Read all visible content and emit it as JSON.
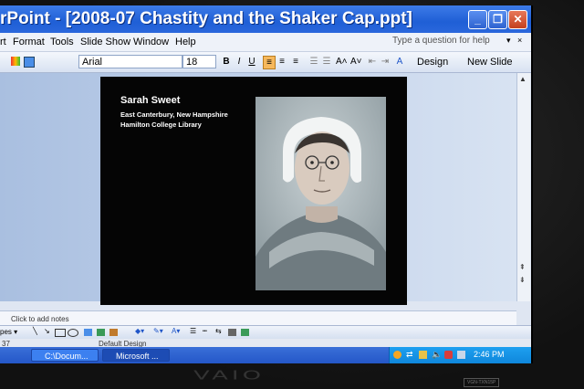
{
  "window": {
    "title": "rPoint - [2008-07 Chastity and the Shaker Cap.ppt]",
    "minimize": "_",
    "maximize": "❐",
    "close": "✕"
  },
  "menu": {
    "items": [
      "rt",
      "Format",
      "Tools",
      "Slide Show",
      "Window",
      "Help"
    ],
    "help_placeholder": "Type a question for help"
  },
  "toolbar": {
    "font": "Arial",
    "size": "18",
    "bold": "B",
    "italic": "I",
    "underline": "U",
    "design": "Design",
    "new_slide": "New Slide"
  },
  "slide": {
    "name": "Sarah Sweet",
    "line1": "East Canterbury, New Hampshire",
    "line2": "Hamilton College Library"
  },
  "notes": {
    "placeholder": "Click to add notes"
  },
  "drawbar": {
    "label": "pes ▾"
  },
  "status": {
    "slide": "37",
    "design": "Default Design"
  },
  "taskbar": {
    "tasks": [
      {
        "label": "C:\\Docum..."
      },
      {
        "label": "Microsoft ..."
      }
    ],
    "clock": "2:46 PM"
  },
  "laptop": {
    "brand": "VAIO",
    "model": "VGN-TXN15P"
  }
}
